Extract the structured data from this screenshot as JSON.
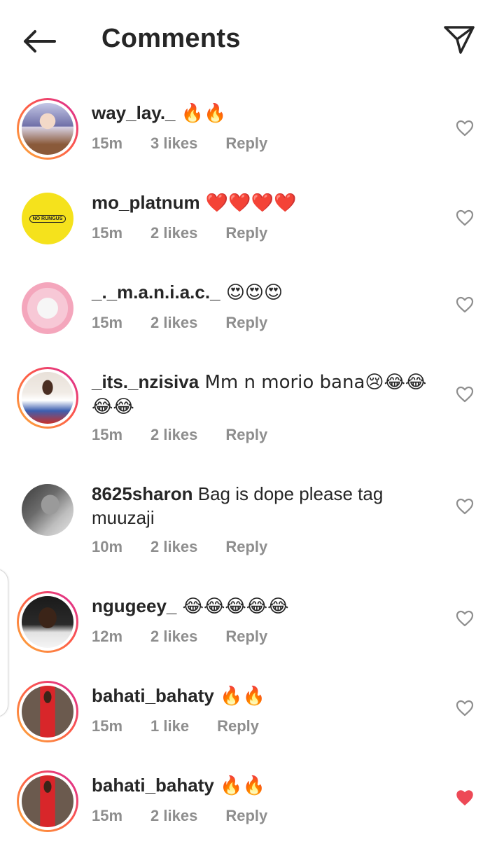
{
  "header": {
    "title": "Comments",
    "back_icon": "arrow-left-icon",
    "send_icon": "paper-plane-icon"
  },
  "colors": {
    "text_primary": "#262626",
    "text_secondary": "#8e8e8e",
    "liked_heart": "#ed4956",
    "story_ring": [
      "#d6249f",
      "#fd5949",
      "#fdae39"
    ]
  },
  "comments": [
    {
      "username": "way_lay._",
      "text": " 🔥🔥",
      "time": "15m",
      "likes": "3 likes",
      "reply": "Reply",
      "liked": false,
      "story_ring": true,
      "avatar_logo": ""
    },
    {
      "username": "mo_platnum",
      "text": " ❤️❤️❤️❤️",
      "time": "15m",
      "likes": "2 likes",
      "reply": "Reply",
      "liked": false,
      "story_ring": false,
      "avatar_logo": "NO RUNGUS"
    },
    {
      "username": "_._m.a.n.i.a.c._",
      "text": " 😍😍😍",
      "time": "15m",
      "likes": "2 likes",
      "reply": "Reply",
      "liked": false,
      "story_ring": false,
      "avatar_logo": ""
    },
    {
      "username": "_its._nzisiva",
      "text": " Mm n morio bana😢😂😂😂😂",
      "time": "15m",
      "likes": "2 likes",
      "reply": "Reply",
      "liked": false,
      "story_ring": true,
      "avatar_logo": ""
    },
    {
      "username": "8625sharon",
      "text": " Bag is dope please tag muuzaji",
      "time": "10m",
      "likes": "2 likes",
      "reply": "Reply",
      "liked": false,
      "story_ring": false,
      "avatar_logo": ""
    },
    {
      "username": "ngugeey_",
      "text": " 😂😂😂😂😂",
      "time": "12m",
      "likes": "2 likes",
      "reply": "Reply",
      "liked": false,
      "story_ring": true,
      "avatar_logo": ""
    },
    {
      "username": "bahati_bahaty",
      "text": " 🔥🔥",
      "time": "15m",
      "likes": "1 like",
      "reply": "Reply",
      "liked": false,
      "story_ring": true,
      "avatar_logo": ""
    },
    {
      "username": "bahati_bahaty",
      "text": " 🔥🔥",
      "time": "15m",
      "likes": "2 likes",
      "reply": "Reply",
      "liked": true,
      "story_ring": true,
      "avatar_logo": ""
    }
  ]
}
